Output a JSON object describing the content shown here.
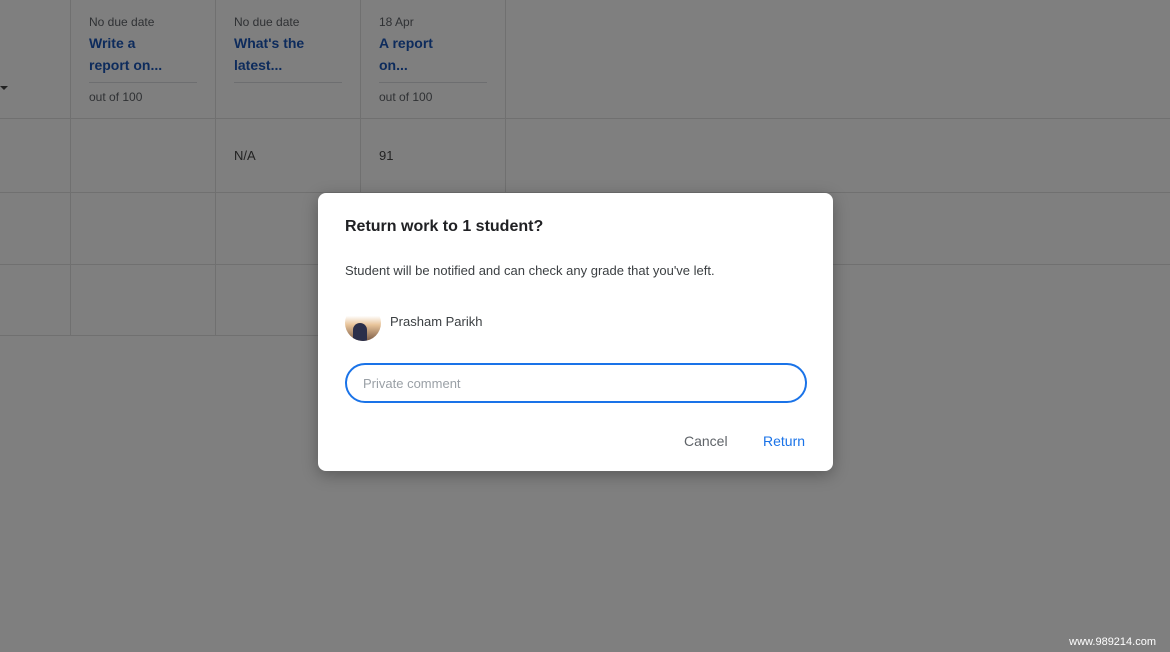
{
  "assignments": [
    {
      "due": "No due date",
      "title": "Write a report on...",
      "points": "out of 100"
    },
    {
      "due": "No due date",
      "title": "What's the latest...",
      "points": ""
    },
    {
      "due": "18 Apr",
      "title": "A report on...",
      "points": "out of 100"
    }
  ],
  "grades": {
    "row1_col2": "N/A",
    "row1_col3": "91"
  },
  "dialog": {
    "title": "Return work to 1 student?",
    "message": "Student will be notified and can check any grade that you've left.",
    "student_name": "Prasham Parikh",
    "comment_placeholder": "Private comment",
    "cancel_label": "Cancel",
    "return_label": "Return"
  },
  "watermark": "www.989214.com",
  "colors": {
    "accent": "#1a73e8",
    "title_link": "#1a56b8",
    "scrim": "rgba(0,0,0,0.5)"
  }
}
